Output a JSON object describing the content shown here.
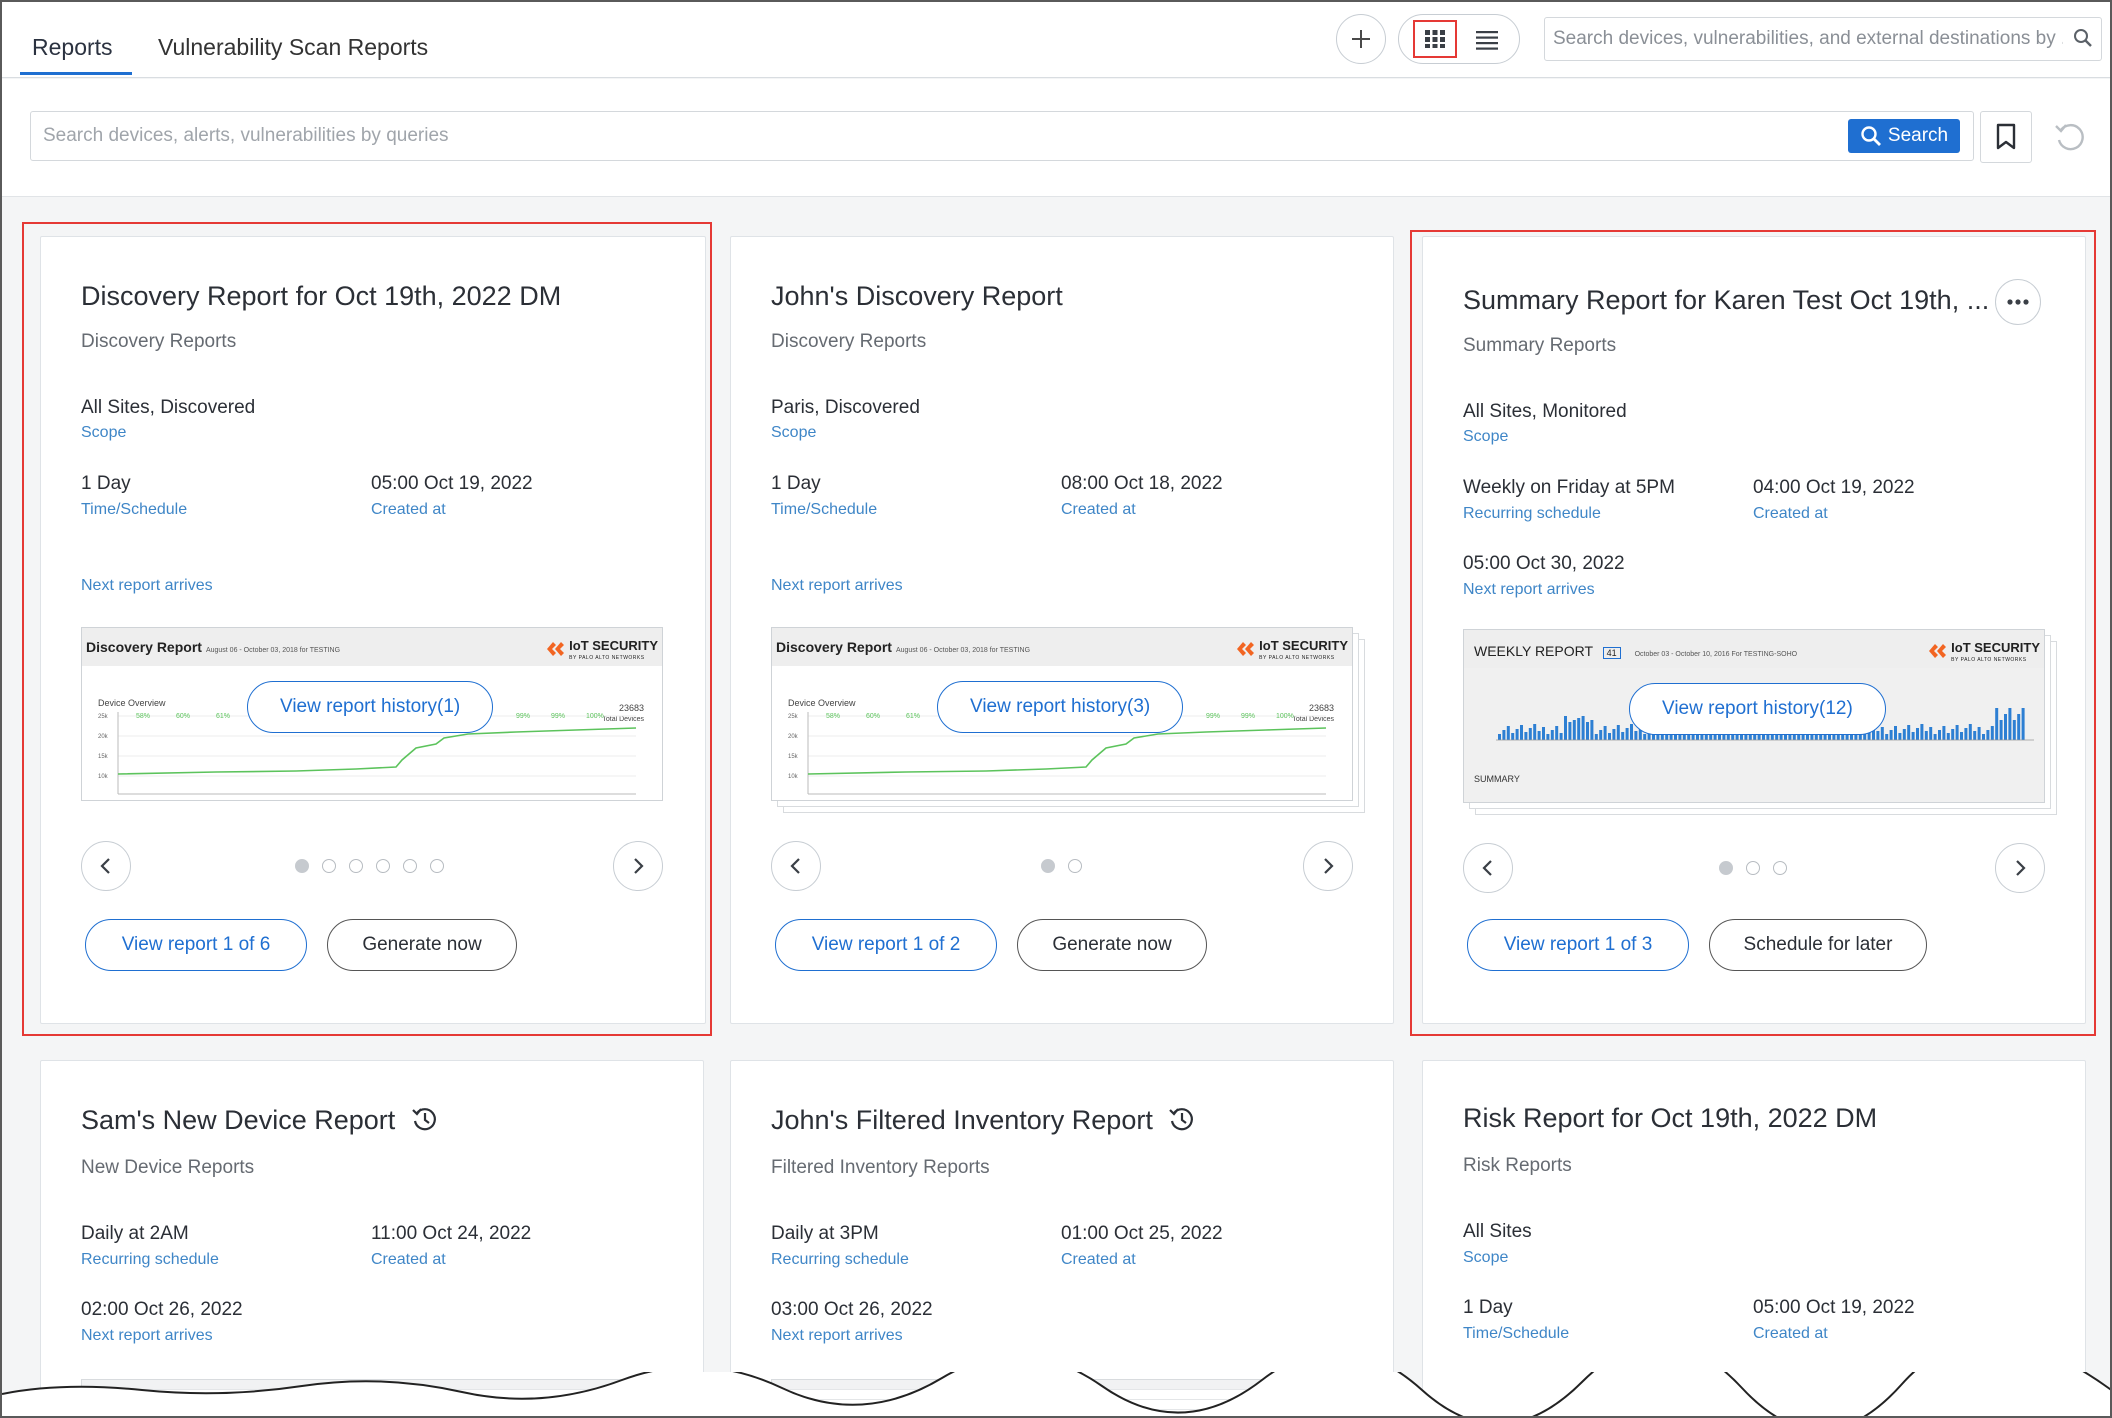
{
  "tabs": {
    "reports": "Reports",
    "vulnerability": "Vulnerability Scan Reports"
  },
  "top_search": {
    "placeholder": "Search devices, vulnerabilities, and external destinations by ..."
  },
  "query_bar": {
    "placeholder": "Search devices, alerts, vulnerabilities by queries",
    "search_label": "Search"
  },
  "cards": [
    {
      "title": "Discovery Report for Oct 19th, 2022 DM",
      "type": "Discovery Reports",
      "scope_value": "All Sites, Discovered",
      "scope_label": "Scope",
      "schedule_value": "1 Day",
      "schedule_label": "Time/Schedule",
      "created_value": "05:00 Oct 19, 2022",
      "created_label": "Created at",
      "next_label": "Next report arrives",
      "preview_title": "Discovery Report",
      "preview_sub": "August 06 - October 03, 2018  for TESTING",
      "preview_chart_label": "Device Overview",
      "preview_total": "23683",
      "preview_total_label": "Total Devices",
      "history": "View report history(1)",
      "view_report": "View report 1 of 6",
      "action": "Generate now",
      "dot_count": 6
    },
    {
      "title": "John's Discovery Report",
      "type": "Discovery Reports",
      "scope_value": "Paris, Discovered",
      "scope_label": "Scope",
      "schedule_value": "1 Day",
      "schedule_label": "Time/Schedule",
      "created_value": "08:00 Oct 18, 2022",
      "created_label": "Created at",
      "next_label": "Next report arrives",
      "preview_title": "Discovery Report",
      "preview_sub": "August 06 - October 03, 2018  for TESTING",
      "preview_chart_label": "Device Overview",
      "preview_total": "23683",
      "preview_total_label": "Total Devices",
      "history": "View report history(3)",
      "view_report": "View report 1 of 2",
      "action": "Generate now",
      "dot_count": 2
    },
    {
      "title": "Summary Report for Karen Test Oct 19th, ...",
      "type": "Summary Reports",
      "scope_value": "All Sites, Monitored",
      "scope_label": "Scope",
      "schedule_value": "Weekly on Friday at 5PM",
      "schedule_label": "Recurring schedule",
      "created_value": "04:00 Oct 19, 2022",
      "created_label": "Created at",
      "next_value": "05:00 Oct 30, 2022",
      "next_label": "Next report arrives",
      "preview_title": "WEEKLY REPORT",
      "preview_week": "41",
      "preview_sub": "October 03 - October 10, 2016  For TESTING-SOHO",
      "preview_summary": "SUMMARY",
      "history": "View report history(12)",
      "view_report": "View report 1 of 3",
      "action": "Schedule for later",
      "dot_count": 3
    },
    {
      "title": "Sam's New Device Report",
      "type": "New Device Reports",
      "schedule_value": "Daily at 2AM",
      "schedule_label": "Recurring schedule",
      "created_value": "11:00 Oct 24, 2022",
      "created_label": "Created at",
      "next_value": "02:00 Oct 26, 2022",
      "next_label": "Next report arrives"
    },
    {
      "title": "John's Filtered Inventory Report",
      "type": "Filtered Inventory Reports",
      "schedule_value": "Daily at 3PM",
      "schedule_label": "Recurring schedule",
      "created_value": "01:00 Oct 25, 2022",
      "created_label": "Created at",
      "next_value": "03:00 Oct 26, 2022",
      "next_label": "Next report arrives"
    },
    {
      "title": "Risk Report for Oct 19th, 2022 DM",
      "type": "Risk Reports",
      "scope_value": "All Sites",
      "scope_label": "Scope",
      "schedule_value": "1 Day",
      "schedule_label": "Time/Schedule",
      "created_value": "05:00 Oct 19, 2022",
      "created_label": "Created at"
    }
  ],
  "preview_brand": {
    "name": "IoT SECURITY",
    "byline": "BY PALO ALTO NETWORKS"
  },
  "colors": {
    "accent": "#1f6fd1",
    "label_blue": "#3f86c7",
    "highlight_red": "#e53935",
    "brand_orange": "#f26522",
    "chart_green": "#5cc35c"
  },
  "icons": {
    "add": "plus-icon",
    "grid_view": "grid-icon",
    "list_view": "list-icon",
    "search": "search-icon",
    "bookmark": "bookmark-icon",
    "refresh": "refresh-icon",
    "more": "more-icon",
    "recurring": "recurring-clock-icon",
    "prev": "chevron-left-icon",
    "next": "chevron-right-icon"
  }
}
